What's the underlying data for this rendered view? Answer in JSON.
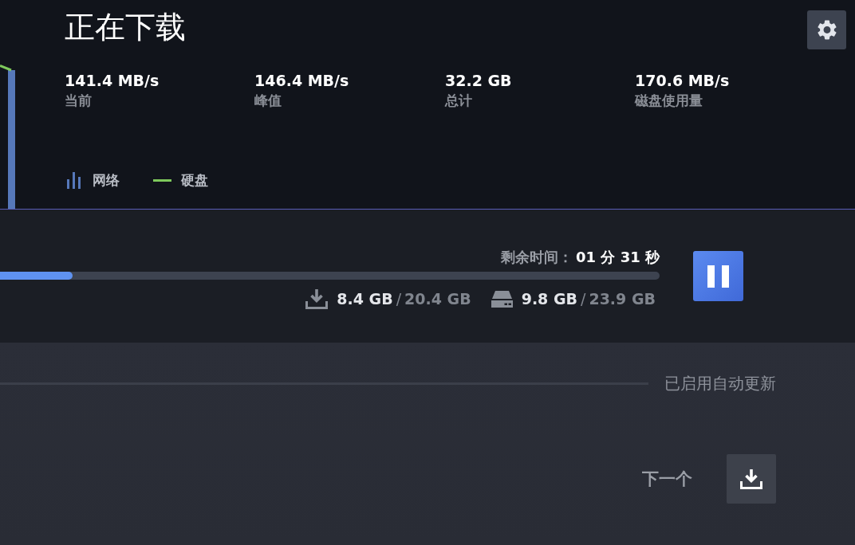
{
  "header": {
    "title": "正在下载"
  },
  "stats": [
    {
      "value": "141.4 MB/s",
      "label": "当前"
    },
    {
      "value": "146.4 MB/s",
      "label": "峰值"
    },
    {
      "value": "32.2 GB",
      "label": "总计"
    },
    {
      "value": "170.6 MB/s",
      "label": "磁盘使用量"
    }
  ],
  "legend": [
    {
      "kind": "bars",
      "label": "网络",
      "color": "#5678ba"
    },
    {
      "kind": "line",
      "label": "硬盘",
      "color": "#7ec95c"
    }
  ],
  "download": {
    "time_remaining_label": "剩余时间：",
    "time_remaining": "01 分 31 秒",
    "progress": {
      "level": 0.11
    },
    "sizes": [
      {
        "kind": "download",
        "done": "8.4 GB",
        "separator": "/",
        "total": "20.4 GB"
      },
      {
        "kind": "disk",
        "done": "9.8 GB",
        "separator": "/",
        "total": "23.9 GB"
      }
    ],
    "paused": false
  },
  "queue": {
    "status": "已启用自动更新",
    "next_label": "下一个"
  }
}
